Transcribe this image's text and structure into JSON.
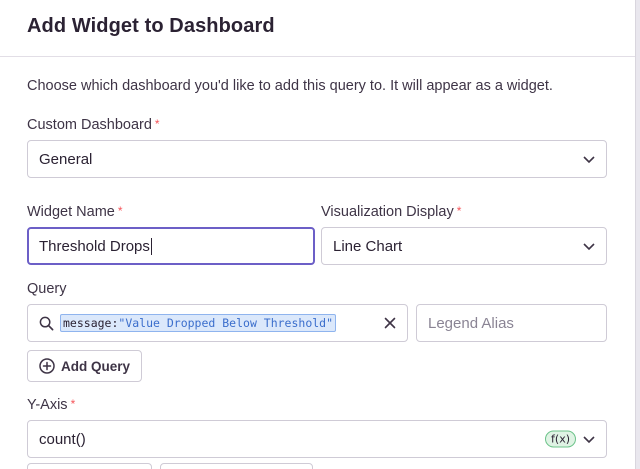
{
  "modal": {
    "title": "Add Widget to Dashboard",
    "description": "Choose which dashboard you'd like to add this query to. It will appear as a widget."
  },
  "fields": {
    "custom_dashboard": {
      "label": "Custom Dashboard",
      "required_mark": "*",
      "value": "General"
    },
    "widget_name": {
      "label": "Widget Name",
      "required_mark": "*",
      "value": "Threshold Drops"
    },
    "visualization": {
      "label": "Visualization Display",
      "required_mark": "*",
      "value": "Line Chart"
    },
    "query": {
      "label": "Query",
      "key": "message:",
      "value": "\"Value Dropped Below Threshold\"",
      "legend_placeholder": "Legend Alias",
      "add_query_label": "Add Query"
    },
    "y_axis": {
      "label": "Y-Axis",
      "required_mark": "*",
      "value": "count()",
      "badge": "f(x)"
    }
  },
  "colors": {
    "accent": "#6c5fc7",
    "required": "#f55459",
    "query_highlight": "#dbe8fb",
    "fx_badge": "#dff3e4"
  }
}
